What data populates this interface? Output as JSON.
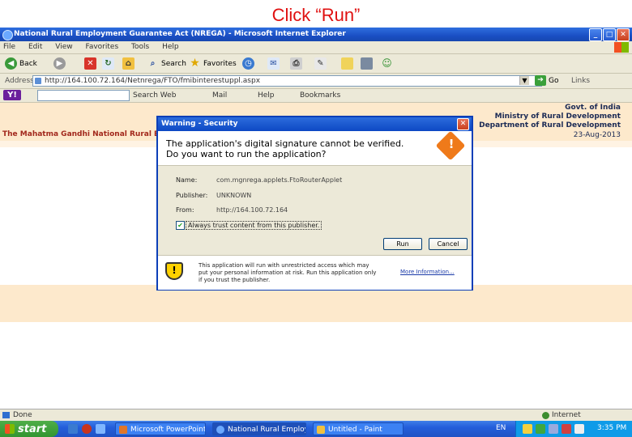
{
  "slide": {
    "caption": "Click “Run”"
  },
  "window": {
    "title": "National Rural Employment Guarantee Act (NREGA) - Microsoft Internet Explorer"
  },
  "menu": [
    "File",
    "Edit",
    "View",
    "Favorites",
    "Tools",
    "Help"
  ],
  "toolbar": {
    "back": "Back",
    "search": "Search",
    "favorites": "Favorites"
  },
  "address": {
    "label": "Address",
    "url": "http://164.100.72.164/Netnrega/FTO/fmibinterestuppl.aspx",
    "go": "Go",
    "links": "Links"
  },
  "yahoo": {
    "logo": "Y!",
    "search_web": "Search Web",
    "items": [
      "Mail",
      "Help",
      "Bookmarks"
    ]
  },
  "page": {
    "gov1": "Govt. of India",
    "gov2": "Ministry of Rural Development",
    "gov3": "Department of Rural Development",
    "date": "23-Aug-2013",
    "left_title": "The Mahatma Gandhi National Rural Em"
  },
  "dialog": {
    "title": "Warning - Security",
    "question_line1": "The application's digital signature cannot be verified.",
    "question_line2": "Do you want to run the application?",
    "name_label": "Name:",
    "name_value": "com.mgnrega.applets.FtoRouterApplet",
    "publisher_label": "Publisher:",
    "publisher_value": "UNKNOWN",
    "from_label": "From:",
    "from_value": "http://164.100.72.164",
    "checkbox_label": "Always trust content from this publisher.",
    "checkbox_checked": true,
    "run_label": "Run",
    "cancel_label": "Cancel",
    "footer_text": "This application will run with unrestricted access which may put your personal information at risk. Run this application only if you trust the publisher.",
    "more_info": "More Information..."
  },
  "status": {
    "text": "Done",
    "zone": "Internet"
  },
  "taskbar": {
    "start": "start",
    "tasks": [
      "Microsoft PowerPoint ...",
      "National Rural Employ...",
      "Untitled - Paint"
    ],
    "lang": "EN",
    "clock": "3:35 PM"
  }
}
